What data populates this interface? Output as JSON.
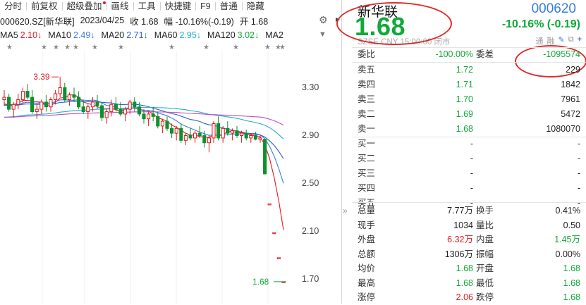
{
  "toolbar": {
    "items": [
      "分时",
      "前复权",
      "超级叠加",
      "画线",
      "工具",
      "快捷键",
      "F9",
      "普通",
      "隐藏"
    ]
  },
  "info_bar": {
    "code": "000620.SZ[新华联]",
    "date": "2023/04/25",
    "close": "收 1.68",
    "change": "幅 -10.16%(-0.19)",
    "open": "开 1.68"
  },
  "ma_bar": [
    {
      "label": "MA5",
      "value": "2.10↓",
      "color": "#e3171d"
    },
    {
      "label": "MA10",
      "value": "2.49↓",
      "color": "#3a7de0"
    },
    {
      "label": "MA20",
      "value": "2.71↓",
      "color": "#2a62c8"
    },
    {
      "label": "MA60",
      "value": "2.95↓",
      "color": "#21b0c8"
    },
    {
      "label": "MA120",
      "value": "3.02↓",
      "color": "#12a83a"
    },
    {
      "label": "MA2",
      "value": "",
      "color": "#222"
    }
  ],
  "chart_data": {
    "type": "candlestick",
    "y_ticks": [
      "3.30",
      "2.90",
      "2.50",
      "2.10",
      "1.70"
    ],
    "annotations": {
      "high_label": "3.39",
      "low_label": "1.68"
    },
    "candles": [
      [
        3.2,
        3.28,
        3.15,
        3.22
      ],
      [
        3.22,
        3.25,
        3.1,
        3.12
      ],
      [
        3.12,
        3.18,
        3.05,
        3.16
      ],
      [
        3.16,
        3.25,
        3.12,
        3.2
      ],
      [
        3.2,
        3.3,
        3.17,
        3.27
      ],
      [
        3.27,
        3.33,
        3.2,
        3.22
      ],
      [
        3.22,
        3.28,
        3.08,
        3.1
      ],
      [
        3.1,
        3.16,
        3.04,
        3.12
      ],
      [
        3.12,
        3.2,
        3.08,
        3.18
      ],
      [
        3.18,
        3.24,
        3.1,
        3.14
      ],
      [
        3.14,
        3.22,
        3.1,
        3.2
      ],
      [
        3.2,
        3.28,
        3.16,
        3.25
      ],
      [
        3.25,
        3.39,
        3.22,
        3.3
      ],
      [
        3.3,
        3.34,
        3.18,
        3.2
      ],
      [
        3.2,
        3.26,
        3.15,
        3.24
      ],
      [
        3.24,
        3.3,
        3.18,
        3.22
      ],
      [
        3.22,
        3.27,
        3.12,
        3.14
      ],
      [
        3.14,
        3.2,
        3.08,
        3.1
      ],
      [
        3.1,
        3.16,
        3.04,
        3.14
      ],
      [
        3.14,
        3.22,
        3.1,
        3.18
      ],
      [
        3.18,
        3.24,
        3.12,
        3.15
      ],
      [
        3.15,
        3.18,
        3.02,
        3.05
      ],
      [
        3.05,
        3.12,
        3.0,
        3.1
      ],
      [
        3.1,
        3.2,
        3.06,
        3.16
      ],
      [
        3.16,
        3.22,
        3.1,
        3.12
      ],
      [
        3.12,
        3.18,
        3.06,
        3.08
      ],
      [
        3.08,
        3.14,
        3.02,
        3.12
      ],
      [
        3.12,
        3.2,
        3.08,
        3.18
      ],
      [
        3.18,
        3.22,
        3.1,
        3.14
      ],
      [
        3.14,
        3.18,
        3.06,
        3.08
      ],
      [
        3.08,
        3.12,
        3.0,
        3.04
      ],
      [
        3.04,
        3.1,
        2.98,
        3.08
      ],
      [
        3.08,
        3.14,
        3.02,
        3.06
      ],
      [
        3.06,
        3.1,
        2.96,
        2.98
      ],
      [
        2.98,
        3.04,
        2.92,
        3.02
      ],
      [
        3.02,
        3.06,
        2.94,
        2.96
      ],
      [
        2.96,
        3.0,
        2.88,
        2.92
      ],
      [
        2.92,
        2.98,
        2.86,
        2.96
      ],
      [
        2.96,
        3.0,
        2.84,
        2.86
      ],
      [
        2.86,
        2.92,
        2.82,
        2.9
      ],
      [
        2.9,
        2.96,
        2.86,
        2.88
      ],
      [
        2.88,
        2.94,
        2.84,
        2.92
      ],
      [
        2.92,
        2.98,
        2.88,
        2.9
      ],
      [
        2.9,
        2.94,
        2.8,
        2.84
      ],
      [
        2.84,
        2.9,
        2.76,
        2.88
      ],
      [
        2.88,
        3.02,
        2.84,
        3.0
      ],
      [
        3.0,
        3.06,
        2.86,
        2.88
      ],
      [
        2.88,
        2.98,
        2.84,
        2.96
      ],
      [
        2.96,
        3.02,
        2.9,
        2.92
      ],
      [
        2.92,
        2.96,
        2.86,
        2.94
      ],
      [
        2.94,
        2.98,
        2.88,
        2.9
      ],
      [
        2.9,
        2.94,
        2.84,
        2.92
      ],
      [
        2.92,
        2.95,
        2.86,
        2.88
      ],
      [
        2.88,
        2.92,
        2.84,
        2.9
      ],
      [
        2.9,
        2.93,
        2.86,
        2.87
      ],
      [
        2.87,
        2.9,
        2.84,
        2.88
      ],
      [
        2.87,
        2.87,
        2.58,
        2.58
      ],
      [
        2.33,
        2.33,
        2.33,
        2.33
      ],
      [
        2.09,
        2.09,
        2.09,
        2.09
      ],
      [
        1.88,
        1.88,
        1.88,
        1.88
      ],
      [
        1.68,
        1.68,
        1.68,
        1.68
      ]
    ],
    "ma_lines": [
      {
        "name": "MA5",
        "color": "#e3171d"
      },
      {
        "name": "MA10",
        "color": "#3a7de0"
      },
      {
        "name": "MA20",
        "color": "#2a62c8"
      },
      {
        "name": "MA60",
        "color": "#21b0c8"
      },
      {
        "name": "MA120",
        "color": "#c04bc8"
      }
    ]
  },
  "quote": {
    "name": "新华联",
    "code": "000620",
    "price": "1.68",
    "change": "-10.16% (-0.19)",
    "market_info": "SZSE  CNY  15:00:00  闭市",
    "mini_icons": [
      "通",
      "融"
    ],
    "weibi_label": "委比",
    "weibi_value": "-100.00%",
    "weicha_label": "委差",
    "weicha_value": "-1095574",
    "orderbook": [
      {
        "label": "卖五",
        "price": "1.72",
        "vol": "229",
        "price_color": "g"
      },
      {
        "label": "卖四",
        "price": "1.71",
        "vol": "1842",
        "price_color": "g"
      },
      {
        "label": "卖三",
        "price": "1.70",
        "vol": "7961",
        "price_color": "g"
      },
      {
        "label": "卖二",
        "price": "1.69",
        "vol": "5472",
        "price_color": "g"
      },
      {
        "label": "卖一",
        "price": "1.68",
        "vol": "1080070",
        "price_color": "g"
      },
      {
        "label": "买一",
        "price": "-",
        "vol": "-",
        "price_color": "k"
      },
      {
        "label": "买二",
        "price": "-",
        "vol": "-",
        "price_color": "k"
      },
      {
        "label": "买三",
        "price": "-",
        "vol": "-",
        "price_color": "k"
      },
      {
        "label": "买四",
        "price": "-",
        "vol": "-",
        "price_color": "k"
      },
      {
        "label": "买五",
        "price": "-",
        "vol": "-",
        "price_color": "k"
      }
    ],
    "stats": [
      {
        "l1": "总量",
        "v1": "7.77万",
        "c1": "k",
        "l2": "换手",
        "v2": "0.41%",
        "c2": "k"
      },
      {
        "l1": "现手",
        "v1": "1034",
        "c1": "k",
        "l2": "量比",
        "v2": "0.50",
        "c2": "k"
      },
      {
        "l1": "外盘",
        "v1": "6.32万",
        "c1": "r",
        "l2": "内盘",
        "v2": "1.45万",
        "c2": "g"
      },
      {
        "l1": "总额",
        "v1": "1306万",
        "c1": "k",
        "l2": "振幅",
        "v2": "0.00%",
        "c2": "k"
      },
      {
        "l1": "均价",
        "v1": "1.68",
        "c1": "g",
        "l2": "开盘",
        "v2": "1.68",
        "c2": "g"
      },
      {
        "l1": "最高",
        "v1": "1.68",
        "c1": "g",
        "l2": "最低",
        "v2": "1.68",
        "c2": "g"
      },
      {
        "l1": "涨停",
        "v1": "2.06",
        "c1": "r",
        "l2": "跌停",
        "v2": "1.68",
        "c2": "g"
      }
    ]
  }
}
